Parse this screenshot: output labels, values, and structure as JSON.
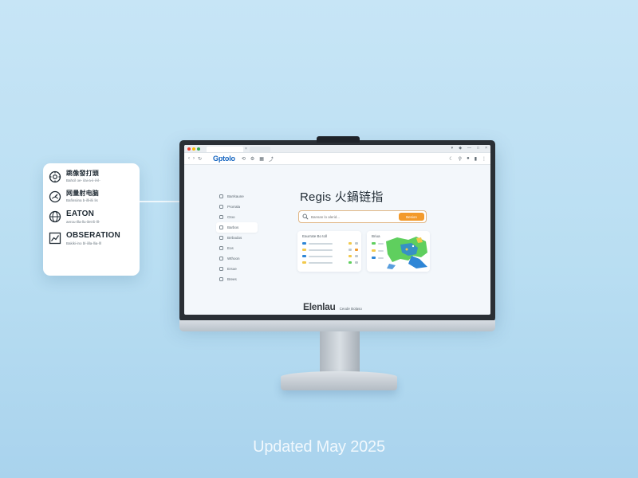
{
  "feature_card": {
    "items": [
      {
        "title": "跳像發打頭",
        "subtitle": "Bahcil oe- ilai-a-ii-il-il-",
        "icon": "gear-icon"
      },
      {
        "title": "网量射电脑",
        "subtitle": "Bafinsiina b-illi-ilii lis",
        "icon": "gauge-icon"
      },
      {
        "title": "EATON",
        "subtitle": "aerou-illa-llu-ilet-ili-lll-",
        "icon": "globe-icon"
      },
      {
        "title": "OBSERATION",
        "subtitle": "Bakiki-ino bl-ilila-llia-lll",
        "icon": "chart-icon"
      }
    ]
  },
  "browser": {
    "brand": "Gptolo",
    "nav": {
      "back": "‹",
      "forward": "›",
      "reload": "↻"
    }
  },
  "sidebar": {
    "items": [
      {
        "label": "Barrkaune"
      },
      {
        "label": "Prorrala"
      },
      {
        "label": "Ctoo"
      },
      {
        "label": "Barbos"
      },
      {
        "label": "Brrbodos"
      },
      {
        "label": "Eos"
      },
      {
        "label": "Wthoon"
      },
      {
        "label": "Ersoe"
      },
      {
        "label": "Brees"
      }
    ]
  },
  "main": {
    "headline": "Regis 火鍋链指",
    "search": {
      "placeholder": "Bansan lo alerid...",
      "button": "Besion"
    },
    "card_left": {
      "title": "Eaurrate Bo toll"
    },
    "card_right": {
      "title": "Briua"
    }
  },
  "screen_footer": {
    "brand": "Elenlau",
    "note": "Ceode Bolaso"
  },
  "caption": "Updated May 2025",
  "colors": {
    "accent_orange": "#f39a2b",
    "brand_blue": "#1565c0",
    "map_green": "#5fcf5e",
    "map_blue": "#2f86d6"
  }
}
